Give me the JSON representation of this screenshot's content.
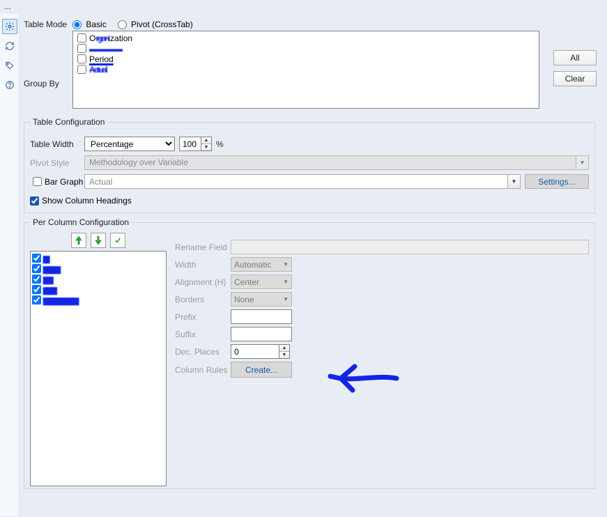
{
  "ellipsis": "...",
  "tableMode": {
    "label": "Table Mode",
    "basic": "Basic",
    "pivot": "Pivot (CrossTab)"
  },
  "groupBy": {
    "label": "Group By",
    "items": [
      {
        "label": "Organization",
        "checked": false
      },
      {
        "label": "",
        "checked": false
      },
      {
        "label": "Period",
        "checked": false
      },
      {
        "label": "Actual",
        "checked": false
      }
    ]
  },
  "sideButtons": {
    "all": "All",
    "clear": "Clear"
  },
  "tableConfig": {
    "legend": "Table Configuration",
    "tableWidth": {
      "label": "Table Width",
      "value": "Percentage",
      "amount": "100",
      "unit": "%"
    },
    "pivotStyle": {
      "label": "Pivot Style",
      "value": "Methodology over Variable"
    },
    "barGraph": {
      "label": "Bar Graph",
      "checked": false,
      "value": "Actual",
      "settings": "Settings..."
    },
    "showHeadings": {
      "label": "Show Column Headings",
      "checked": true
    }
  },
  "perColumn": {
    "legend": "Per Column Configuration",
    "listItems": [
      {
        "checked": true
      },
      {
        "checked": true
      },
      {
        "checked": true
      },
      {
        "checked": true
      },
      {
        "checked": true
      }
    ],
    "fields": {
      "rename": {
        "label": "Rename Field",
        "value": ""
      },
      "width": {
        "label": "Width",
        "value": "Automatic"
      },
      "align": {
        "label": "Alignment (H)",
        "value": "Center"
      },
      "borders": {
        "label": "Borders",
        "value": "None"
      },
      "prefix": {
        "label": "Prefix",
        "value": ""
      },
      "suffix": {
        "label": "Suffix",
        "value": ""
      },
      "dec": {
        "label": "Dec. Places",
        "value": "0"
      },
      "rules": {
        "label": "Column Rules",
        "button": "Create..."
      }
    }
  },
  "toolbar": {
    "icons": [
      "gear-icon",
      "refresh-icon",
      "tag-icon",
      "help-icon"
    ]
  }
}
